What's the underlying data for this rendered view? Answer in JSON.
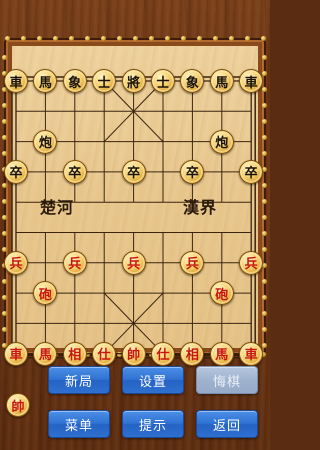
{
  "board": {
    "river_left": "楚河",
    "river_right": "漢界"
  },
  "pieces": [
    {
      "label": "車",
      "side": "black",
      "col": 0,
      "row": 0
    },
    {
      "label": "馬",
      "side": "black",
      "col": 1,
      "row": 0
    },
    {
      "label": "象",
      "side": "black",
      "col": 2,
      "row": 0
    },
    {
      "label": "士",
      "side": "black",
      "col": 3,
      "row": 0
    },
    {
      "label": "將",
      "side": "black",
      "col": 4,
      "row": 0
    },
    {
      "label": "士",
      "side": "black",
      "col": 5,
      "row": 0
    },
    {
      "label": "象",
      "side": "black",
      "col": 6,
      "row": 0
    },
    {
      "label": "馬",
      "side": "black",
      "col": 7,
      "row": 0
    },
    {
      "label": "車",
      "side": "black",
      "col": 8,
      "row": 0
    },
    {
      "label": "炮",
      "side": "black",
      "col": 1,
      "row": 2
    },
    {
      "label": "炮",
      "side": "black",
      "col": 7,
      "row": 2
    },
    {
      "label": "卒",
      "side": "black",
      "col": 0,
      "row": 3
    },
    {
      "label": "卒",
      "side": "black",
      "col": 2,
      "row": 3
    },
    {
      "label": "卒",
      "side": "black",
      "col": 4,
      "row": 3
    },
    {
      "label": "卒",
      "side": "black",
      "col": 6,
      "row": 3
    },
    {
      "label": "卒",
      "side": "black",
      "col": 8,
      "row": 3
    },
    {
      "label": "兵",
      "side": "red",
      "col": 0,
      "row": 6
    },
    {
      "label": "兵",
      "side": "red",
      "col": 2,
      "row": 6
    },
    {
      "label": "兵",
      "side": "red",
      "col": 4,
      "row": 6
    },
    {
      "label": "兵",
      "side": "red",
      "col": 6,
      "row": 6
    },
    {
      "label": "兵",
      "side": "red",
      "col": 8,
      "row": 6
    },
    {
      "label": "砲",
      "side": "red",
      "col": 1,
      "row": 7
    },
    {
      "label": "砲",
      "side": "red",
      "col": 7,
      "row": 7
    },
    {
      "label": "車",
      "side": "red",
      "col": 0,
      "row": 9
    },
    {
      "label": "馬",
      "side": "red",
      "col": 1,
      "row": 9
    },
    {
      "label": "相",
      "side": "red",
      "col": 2,
      "row": 9
    },
    {
      "label": "仕",
      "side": "red",
      "col": 3,
      "row": 9
    },
    {
      "label": "帥",
      "side": "red",
      "col": 4,
      "row": 9
    },
    {
      "label": "仕",
      "side": "red",
      "col": 5,
      "row": 9
    },
    {
      "label": "相",
      "side": "red",
      "col": 6,
      "row": 9
    },
    {
      "label": "馬",
      "side": "red",
      "col": 7,
      "row": 9
    },
    {
      "label": "車",
      "side": "red",
      "col": 8,
      "row": 9
    }
  ],
  "turn_indicator": {
    "label": "帥",
    "side": "red"
  },
  "buttons": {
    "new_game": "新局",
    "settings": "设置",
    "undo": "悔棋",
    "menu": "菜单",
    "hint": "提示",
    "back": "返回"
  },
  "colors": {
    "button_blue": "#2f72d3",
    "button_disabled": "#9fb3cf",
    "red_piece_text": "#c8160f",
    "black_piece_text": "#1a1208",
    "board_light": "#efd3a0"
  }
}
